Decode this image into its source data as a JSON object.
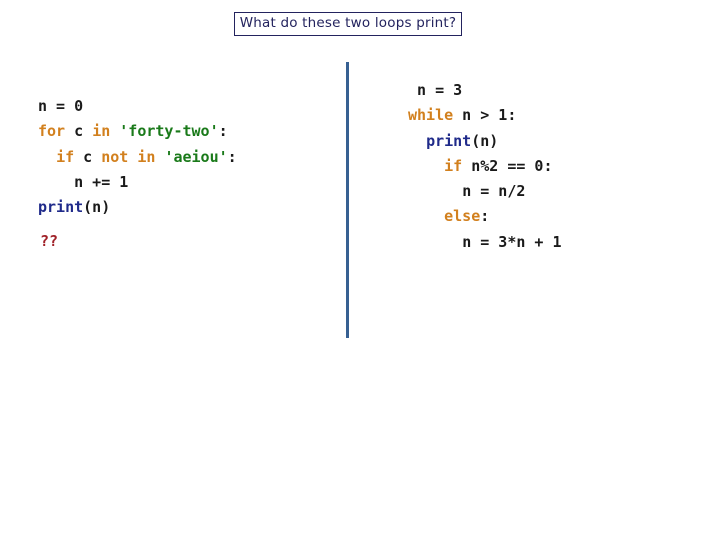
{
  "slide": {
    "title": "What do these two loops print?",
    "background_color": "#ffffff"
  },
  "colors": {
    "title_text": "#23235e",
    "title_border": "#23235e",
    "divider": "#376092",
    "keyword": "#d2801e",
    "string": "#1a7a1a",
    "function": "#1f2a8a",
    "plain": "#1a1a1a",
    "answer": "#a02128"
  },
  "code_left": {
    "lines": [
      {
        "indent": "",
        "tokens": [
          {
            "t": "n = 0",
            "c": "pl"
          }
        ]
      },
      {
        "indent": "",
        "tokens": [
          {
            "t": "for",
            "c": "kw"
          },
          {
            "t": " c ",
            "c": "pl"
          },
          {
            "t": "in",
            "c": "kw"
          },
          {
            "t": " ",
            "c": "pl"
          },
          {
            "t": "'forty-two'",
            "c": "str"
          },
          {
            "t": ":",
            "c": "pl"
          }
        ]
      },
      {
        "indent": "  ",
        "tokens": [
          {
            "t": "if",
            "c": "kw"
          },
          {
            "t": " c ",
            "c": "pl"
          },
          {
            "t": "not in",
            "c": "kw"
          },
          {
            "t": " ",
            "c": "pl"
          },
          {
            "t": "'aeiou'",
            "c": "str"
          },
          {
            "t": ":",
            "c": "pl"
          }
        ]
      },
      {
        "indent": "    ",
        "tokens": [
          {
            "t": "n += 1",
            "c": "pl"
          }
        ]
      },
      {
        "indent": "",
        "tokens": [
          {
            "t": "print",
            "c": "fn"
          },
          {
            "t": "(n)",
            "c": "pl"
          }
        ]
      }
    ]
  },
  "code_right": {
    "lines": [
      {
        "indent": " ",
        "tokens": [
          {
            "t": "n = 3",
            "c": "pl"
          }
        ]
      },
      {
        "indent": "",
        "tokens": [
          {
            "t": "while",
            "c": "kw"
          },
          {
            "t": " n > 1:",
            "c": "pl"
          }
        ]
      },
      {
        "indent": "  ",
        "tokens": [
          {
            "t": "print",
            "c": "fn"
          },
          {
            "t": "(n)",
            "c": "pl"
          }
        ]
      },
      {
        "indent": "    ",
        "tokens": [
          {
            "t": "if",
            "c": "kw"
          },
          {
            "t": " n%2 == 0:",
            "c": "pl"
          }
        ]
      },
      {
        "indent": "      ",
        "tokens": [
          {
            "t": "n = n/2",
            "c": "pl"
          }
        ]
      },
      {
        "indent": "    ",
        "tokens": [
          {
            "t": "else",
            "c": "kw"
          },
          {
            "t": ":",
            "c": "pl"
          }
        ]
      },
      {
        "indent": "      ",
        "tokens": [
          {
            "t": "n = 3*n + 1",
            "c": "pl"
          }
        ]
      }
    ]
  },
  "answer": {
    "text": "??"
  }
}
